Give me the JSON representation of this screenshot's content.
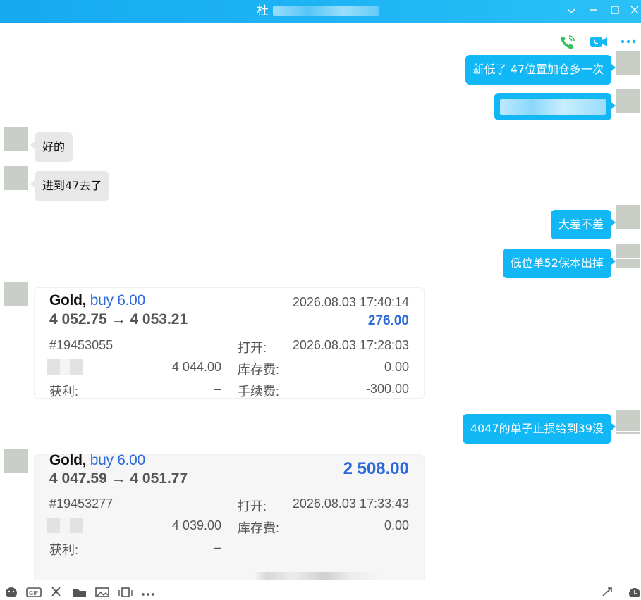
{
  "window": {
    "title": "杜"
  },
  "header_actions": [
    "phone-call",
    "video-call",
    "more"
  ],
  "messages": [
    {
      "side": "out",
      "text": "新低了 47位置加仓多一次"
    },
    {
      "side": "out",
      "text": ""
    },
    {
      "side": "in",
      "text": "好的"
    },
    {
      "side": "in",
      "text": "进到47去了"
    },
    {
      "side": "out",
      "text": "大差不差"
    },
    {
      "side": "out",
      "text": "低位单52保本出掉"
    },
    {
      "side": "out",
      "text": "4047的单子止损给到39没"
    }
  ],
  "trades": [
    {
      "symbol": "Gold,",
      "direction": "buy 6.00",
      "prices": "4 052.75 → 4 053.21",
      "close_time": "2026.08.03 17:40:14",
      "profit": "276.00",
      "order_id": "#19453055",
      "sl_value": "4 044.00",
      "tp_label": "获利:",
      "tp_value": "–",
      "open_label": "打开:",
      "open_time": "2026.08.03 17:28:03",
      "swap_label": "库存费:",
      "swap_value": "0.00",
      "fee_label": "手续费:",
      "fee_value": "-300.00"
    },
    {
      "symbol": "Gold,",
      "direction": "buy 6.00",
      "prices": "4 047.59 → 4 051.77",
      "profit": "2 508.00",
      "order_id": "#19453277",
      "sl_value": "4 039.00",
      "tp_label": "获利:",
      "tp_value": "–",
      "open_label": "打开:",
      "open_time": "2026.08.03 17:33:43",
      "swap_label": "库存费:",
      "swap_value": "0.00"
    }
  ],
  "bottom_toolbar": [
    "emoji",
    "gif",
    "scissors",
    "folder",
    "image",
    "shake",
    "more",
    "expand",
    "history"
  ],
  "colors": {
    "titlebar": "#16a9f1",
    "outgoing_bubble": "#12b7f5",
    "incoming_bubble": "#e8e8e8",
    "profit": "#2b6ad8",
    "call": "#2fc25b"
  }
}
